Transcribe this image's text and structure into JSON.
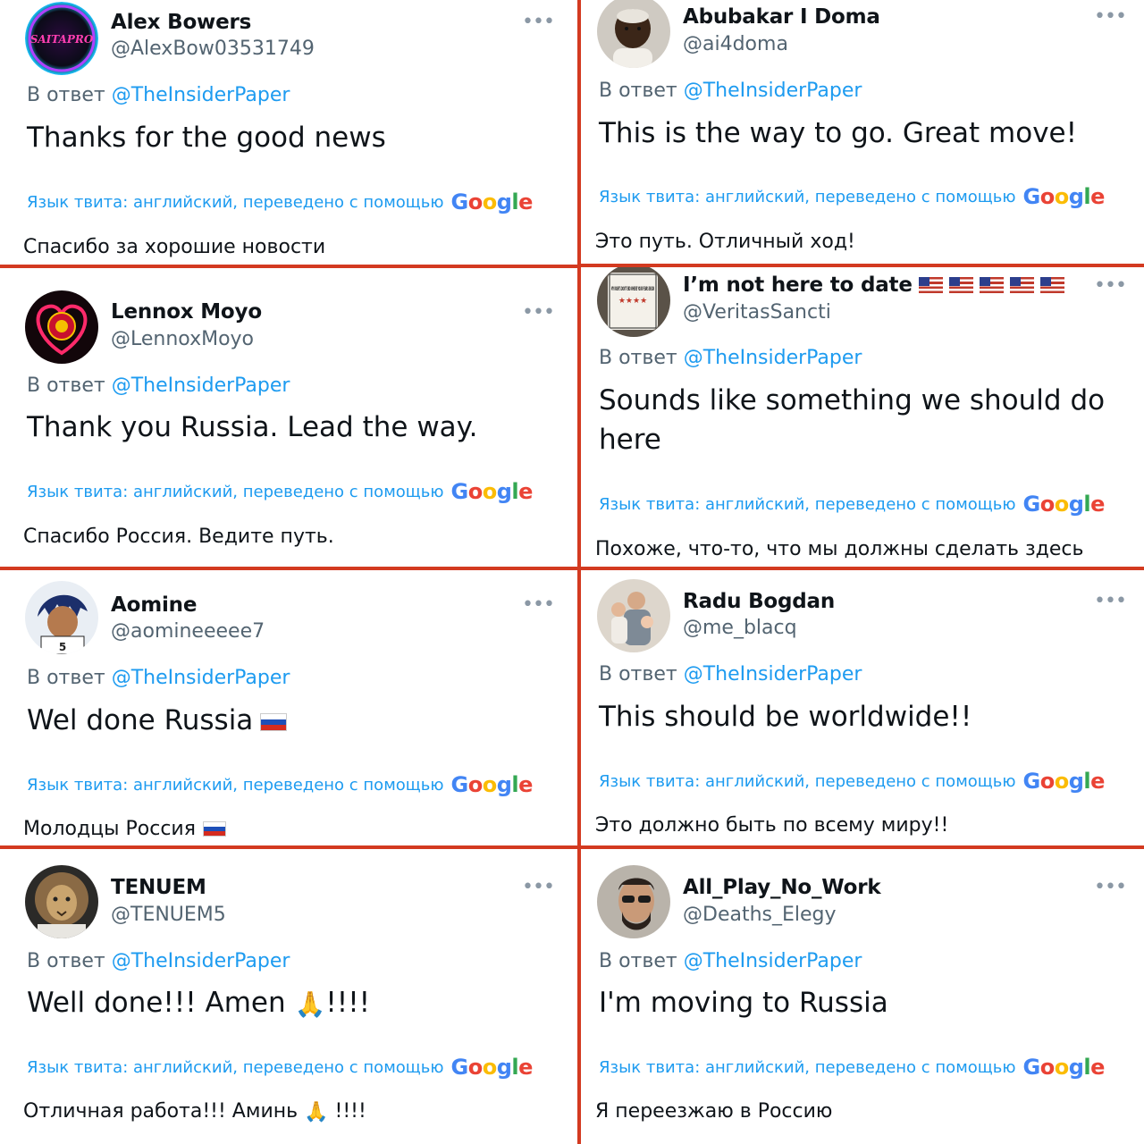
{
  "common": {
    "reply_prefix": "В ответ",
    "reply_mention": "@TheInsiderPaper",
    "translate_label": "Язык твита: английский, переведено с помощью",
    "more_glyph": "•••",
    "google_letters": [
      "G",
      "o",
      "o",
      "g",
      "l",
      "e"
    ],
    "divider_color": "#d33a20",
    "link_color": "#1d9bf0"
  },
  "tweets": [
    {
      "name": "Alex Bowers",
      "handle": "@AlexBow03531749",
      "text": "Thanks for the good news",
      "translation": "Спасибо за хорошие новости",
      "avatar_text": "SAITAPRO"
    },
    {
      "name": "Abubakar I Doma",
      "handle": "@ai4doma",
      "text": "This is the way to go. Great move!",
      "translation": "Это путь. Отличный ход!"
    },
    {
      "name": "Lennox Moyo",
      "handle": "@LennoxMoyo",
      "text": "Thank you Russia. Lead the way.",
      "translation": "Спасибо Россия. Ведите путь."
    },
    {
      "name": "I’m not here to date",
      "handle": "@VeritasSancti",
      "text_line1": "Sounds like something we should do",
      "text_line2": "here",
      "translation": "Похоже, что-то, что мы должны сделать здесь",
      "avatar_text": "MY RIGHTS DON'T END WHERE YOUR FEARS BEGIN"
    },
    {
      "name": "Aomine",
      "handle": "@aomineeeee7",
      "text": "Wel done Russia",
      "translation": "Молодцы Россия"
    },
    {
      "name": "Radu Bogdan",
      "handle": "@me_blacq",
      "text": "This should be worldwide!!",
      "translation": "Это должно быть по всему миру!!"
    },
    {
      "name": "TENUEM",
      "handle": "@TENUEM5",
      "text_before": "Well done!!! Amen",
      "text_after": "!!!!",
      "translation_before": "Отличная работа!!! Аминь",
      "translation_after": "!!!!"
    },
    {
      "name": "All_Play_No_Work",
      "handle": "@Deaths_Elegy",
      "text": "I'm moving to Russia",
      "translation": "Я переезжаю в Россию"
    }
  ]
}
